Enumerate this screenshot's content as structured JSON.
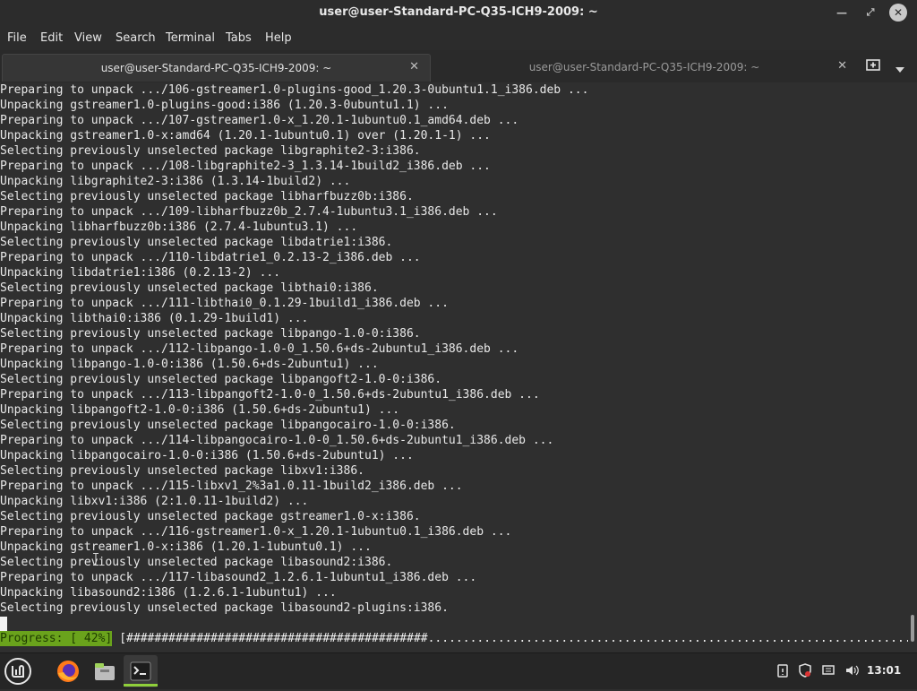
{
  "window": {
    "title": "user@user-Standard-PC-Q35-ICH9-2009: ~"
  },
  "menu": [
    "File",
    "Edit",
    "View",
    "Search",
    "Terminal",
    "Tabs",
    "Help"
  ],
  "tabs": [
    {
      "label": "user@user-Standard-PC-Q35-ICH9-2009: ~",
      "active": true
    },
    {
      "label": "user@user-Standard-PC-Q35-ICH9-2009: ~",
      "active": false
    }
  ],
  "icons": {
    "minimize": "minimize-icon",
    "maximize": "maximize-icon",
    "close": "close-icon",
    "tab_close": "close-icon",
    "new_tab": "plus-icon",
    "tab_menu": "chevron-down-icon"
  },
  "terminal": {
    "lines": [
      "Preparing to unpack .../106-gstreamer1.0-plugins-good_1.20.3-0ubuntu1.1_i386.deb ...",
      "Unpacking gstreamer1.0-plugins-good:i386 (1.20.3-0ubuntu1.1) ...",
      "Preparing to unpack .../107-gstreamer1.0-x_1.20.1-1ubuntu0.1_amd64.deb ...",
      "Unpacking gstreamer1.0-x:amd64 (1.20.1-1ubuntu0.1) over (1.20.1-1) ...",
      "Selecting previously unselected package libgraphite2-3:i386.",
      "Preparing to unpack .../108-libgraphite2-3_1.3.14-1build2_i386.deb ...",
      "Unpacking libgraphite2-3:i386 (1.3.14-1build2) ...",
      "Selecting previously unselected package libharfbuzz0b:i386.",
      "Preparing to unpack .../109-libharfbuzz0b_2.7.4-1ubuntu3.1_i386.deb ...",
      "Unpacking libharfbuzz0b:i386 (2.7.4-1ubuntu3.1) ...",
      "Selecting previously unselected package libdatrie1:i386.",
      "Preparing to unpack .../110-libdatrie1_0.2.13-2_i386.deb ...",
      "Unpacking libdatrie1:i386 (0.2.13-2) ...",
      "Selecting previously unselected package libthai0:i386.",
      "Preparing to unpack .../111-libthai0_0.1.29-1build1_i386.deb ...",
      "Unpacking libthai0:i386 (0.1.29-1build1) ...",
      "Selecting previously unselected package libpango-1.0-0:i386.",
      "Preparing to unpack .../112-libpango-1.0-0_1.50.6+ds-2ubuntu1_i386.deb ...",
      "Unpacking libpango-1.0-0:i386 (1.50.6+ds-2ubuntu1) ...",
      "Selecting previously unselected package libpangoft2-1.0-0:i386.",
      "Preparing to unpack .../113-libpangoft2-1.0-0_1.50.6+ds-2ubuntu1_i386.deb ...",
      "Unpacking libpangoft2-1.0-0:i386 (1.50.6+ds-2ubuntu1) ...",
      "Selecting previously unselected package libpangocairo-1.0-0:i386.",
      "Preparing to unpack .../114-libpangocairo-1.0-0_1.50.6+ds-2ubuntu1_i386.deb ...",
      "Unpacking libpangocairo-1.0-0:i386 (1.50.6+ds-2ubuntu1) ...",
      "Selecting previously unselected package libxv1:i386.",
      "Preparing to unpack .../115-libxv1_2%3a1.0.11-1build2_i386.deb ...",
      "Unpacking libxv1:i386 (2:1.0.11-1build2) ...",
      "Selecting previously unselected package gstreamer1.0-x:i386.",
      "Preparing to unpack .../116-gstreamer1.0-x_1.20.1-1ubuntu0.1_i386.deb ...",
      "Unpacking gstreamer1.0-x:i386 (1.20.1-1ubuntu0.1) ...",
      "Selecting previously unselected package libasound2:i386.",
      "Preparing to unpack .../117-libasound2_1.2.6.1-1ubuntu1_i386.deb ...",
      "Unpacking libasound2:i386 (1.2.6.1-1ubuntu1) ...",
      "Selecting previously unselected package libasound2-plugins:i386."
    ],
    "progress_label": "Progress: [ 42%]",
    "progress_percent": 42,
    "progress_bar": "[###########################################.....................................................................]"
  },
  "taskbar": {
    "apps": [
      "menu-icon",
      "firefox-icon",
      "files-icon",
      "terminal-icon"
    ],
    "tray": [
      "clipboard-icon",
      "shield-icon",
      "network-icon",
      "volume-icon"
    ],
    "clock": "13:01"
  },
  "colors": {
    "progress_bg": "#6aa31c",
    "terminal_bg": "#2f2f2f",
    "accent": "#8fcf3a"
  }
}
